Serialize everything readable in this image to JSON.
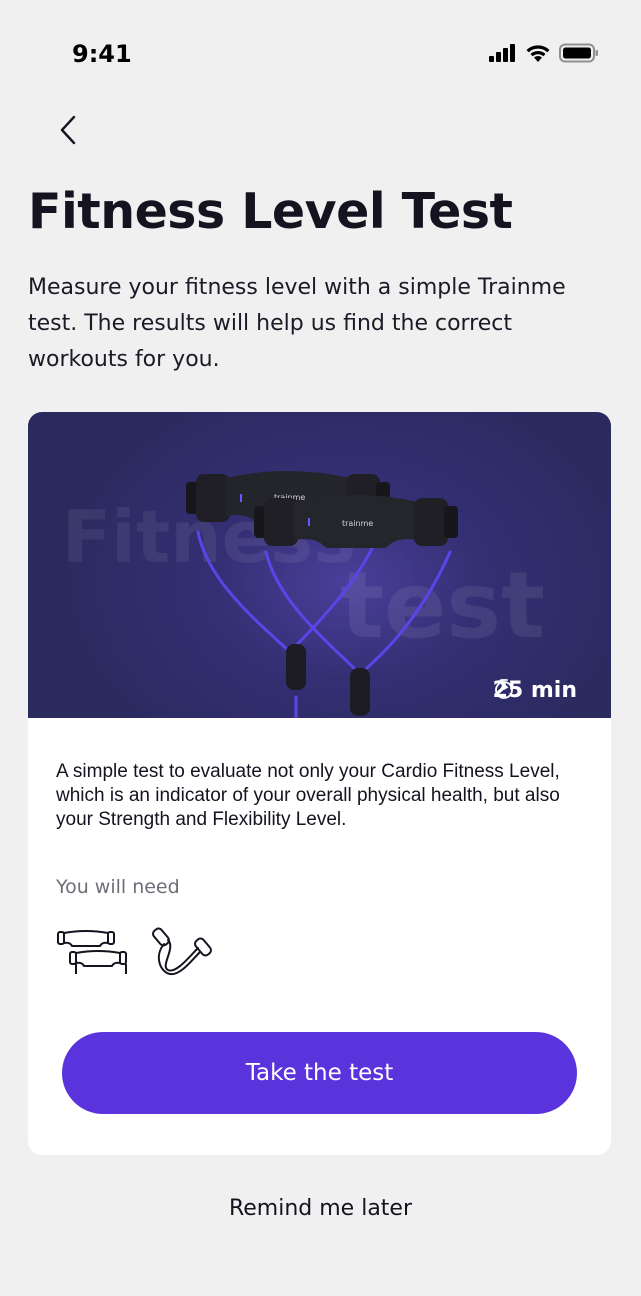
{
  "status_bar": {
    "time": "9:41",
    "icons": [
      "cellular-signal-icon",
      "wifi-icon",
      "battery-icon"
    ]
  },
  "header": {
    "back_icon": "chevron-left-icon"
  },
  "title": "Fitness Level Test",
  "description": "Measure your fitness level with a simple Trainme test. The results will help us find the correct workouts for you.",
  "card": {
    "hero": {
      "watermark_line1": "Fitness",
      "watermark_line2": "test",
      "brand_text": "trainme",
      "duration": "25 min",
      "duration_icon": "stopwatch-icon"
    },
    "text": "A simple test to evaluate not only your Cardio Fitness Level, which is an indicator of your overall physical health, but also your Strength and Flexibility Level.",
    "need_label": "You will need",
    "equipment_icons": [
      "handles-icon",
      "jump-rope-icon"
    ],
    "cta_label": "Take the test"
  },
  "remind_label": "Remind me later",
  "colors": {
    "background": "#f0f0f0",
    "accent": "#5b33dc",
    "hero_bg": "#2f2c6a",
    "rope": "#5b45e8",
    "text_primary": "#14131f",
    "text_secondary": "#6f6e78"
  }
}
